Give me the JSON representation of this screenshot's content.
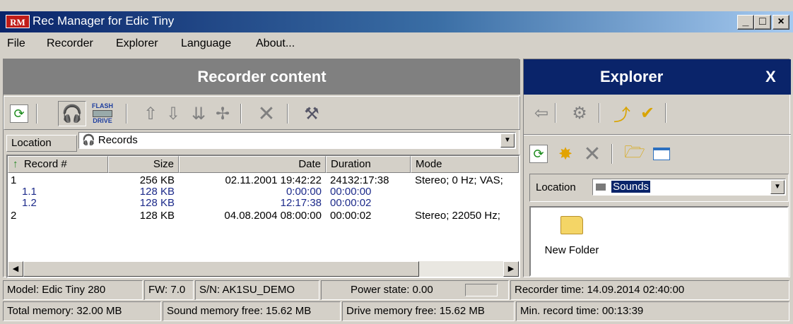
{
  "window": {
    "title": "Rec Manager for Edic Tiny",
    "icon_text": "RM",
    "controls": {
      "minimize": "_",
      "maximize": "□",
      "close": "×"
    }
  },
  "menu": [
    {
      "label": "File"
    },
    {
      "label": "Recorder"
    },
    {
      "label": "Explorer"
    },
    {
      "label": "Language"
    },
    {
      "label": "About..."
    }
  ],
  "recorder": {
    "header": "Recorder content",
    "flash_label_1": "FLASH",
    "flash_label_2": "DRIVE",
    "location_label": "Location",
    "location_value": "Records",
    "columns": [
      "Record #",
      "Size",
      "Date",
      "Duration",
      "Mode"
    ],
    "rows": [
      {
        "record": "1",
        "size": "256 KB",
        "date": "02.11.2001 19:42:22",
        "duration": "24132:17:38",
        "mode": "Stereo; 0 Hz; VAS;",
        "child": false
      },
      {
        "record": "1.1",
        "size": "128 KB",
        "date": "0:00:00",
        "duration": "00:00:00",
        "mode": "",
        "child": true
      },
      {
        "record": "1.2",
        "size": "128 KB",
        "date": "12:17:38",
        "duration": "00:00:02",
        "mode": "",
        "child": true
      },
      {
        "record": "2",
        "size": "128 KB",
        "date": "04.08.2004 08:00:00",
        "duration": "00:00:02",
        "mode": "Stereo; 22050 Hz;",
        "child": false
      }
    ]
  },
  "explorer": {
    "header": "Explorer",
    "close": "X",
    "location_label": "Location",
    "location_value": "Sounds",
    "items": [
      {
        "label": "New Folder"
      }
    ]
  },
  "status": {
    "model": "Model: Edic Tiny 280",
    "fw": "FW: 7.0",
    "sn": "S/N: AK1SU_DEMO",
    "power": "Power state: 0.00",
    "recorder_time": "Recorder time: 14.09.2014 02:40:00",
    "total_memory": "Total memory: 32.00 MB",
    "sound_free": "Sound memory free: 15.62 MB",
    "drive_free": "Drive memory free: 15.62 MB",
    "min_record": "Min. record time: 00:13:39"
  },
  "colors": {
    "title_start": "#0a246a",
    "title_end": "#a6caf0",
    "recorder_header": "#808080",
    "explorer_header": "#0a246a",
    "child_row": "#1c2a8a"
  }
}
